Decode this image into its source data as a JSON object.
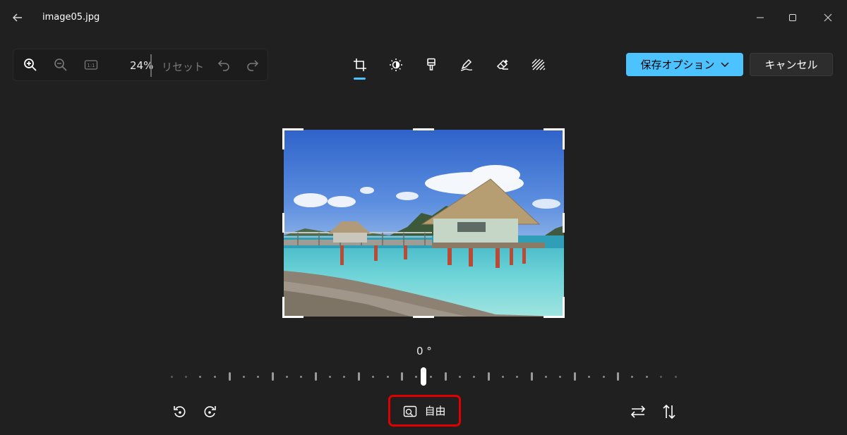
{
  "window": {
    "title": "image05.jpg",
    "back_icon": "arrow-left-icon",
    "minimize_icon": "minimize-icon",
    "maximize_icon": "maximize-icon",
    "close_icon": "close-icon"
  },
  "zoom_toolbar": {
    "zoom_in_icon": "zoom-in-icon",
    "zoom_out_icon": "zoom-out-icon",
    "actual_size_icon": "actual-size-icon",
    "zoom_value": "24%",
    "reset_label": "リセット",
    "undo_icon": "undo-icon",
    "redo_icon": "redo-icon"
  },
  "edit_tools": [
    {
      "name": "crop-icon",
      "active": true
    },
    {
      "name": "brightness-icon",
      "active": false
    },
    {
      "name": "filter-brush-icon",
      "active": false
    },
    {
      "name": "markup-pen-icon",
      "active": false
    },
    {
      "name": "erase-icon",
      "active": false
    },
    {
      "name": "background-blur-icon",
      "active": false
    }
  ],
  "actions": {
    "save_label": "保存オプション",
    "cancel_label": "キャンセル"
  },
  "straighten": {
    "angle_label": "0 °",
    "angle_value": 0
  },
  "bottom_bar": {
    "rotate_left_icon": "rotate-left-icon",
    "rotate_right_icon": "rotate-right-icon",
    "aspect_label": "自由",
    "aspect_icon": "aspect-ratio-icon",
    "flip_horizontal_icon": "flip-horizontal-icon",
    "flip_vertical_icon": "flip-vertical-icon"
  },
  "colors": {
    "accent": "#4cc2ff",
    "highlight": "#e00000",
    "background": "#202020"
  }
}
